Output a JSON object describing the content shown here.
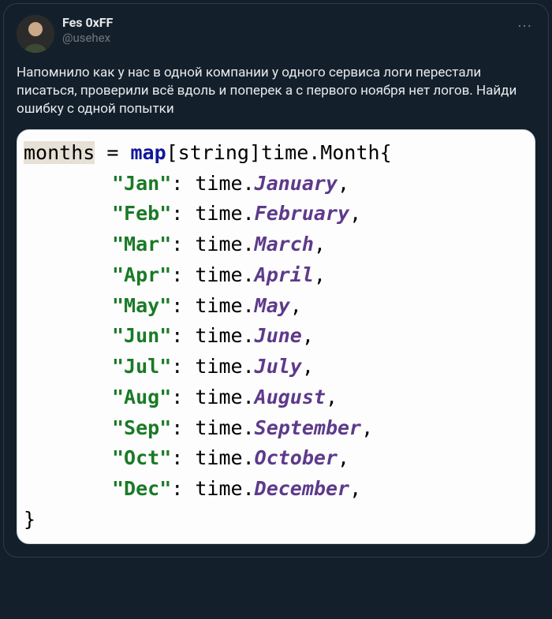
{
  "user": {
    "display_name": "Fes 0xFF",
    "handle": "@usehex"
  },
  "more_label": "···",
  "body": "Напомнило как у нас в одной компании у одного сервиса логи перестали писаться, проверили всё вдоль и поперек а с первого ноября нет логов. Найди ошибку с одной попытки",
  "code": {
    "var_name": "months",
    "assign": " = ",
    "map_kw": "map",
    "map_key_type": "[string]",
    "map_val_type": "time.Month",
    "open": "{",
    "close": "}",
    "entries": [
      {
        "key": "\"Jan\"",
        "sep": ": ",
        "obj": "time.",
        "prop": "January",
        "comma": ","
      },
      {
        "key": "\"Feb\"",
        "sep": ": ",
        "obj": "time.",
        "prop": "February",
        "comma": ","
      },
      {
        "key": "\"Mar\"",
        "sep": ": ",
        "obj": "time.",
        "prop": "March",
        "comma": ","
      },
      {
        "key": "\"Apr\"",
        "sep": ": ",
        "obj": "time.",
        "prop": "April",
        "comma": ","
      },
      {
        "key": "\"May\"",
        "sep": ": ",
        "obj": "time.",
        "prop": "May",
        "comma": ","
      },
      {
        "key": "\"Jun\"",
        "sep": ": ",
        "obj": "time.",
        "prop": "June",
        "comma": ","
      },
      {
        "key": "\"Jul\"",
        "sep": ": ",
        "obj": "time.",
        "prop": "July",
        "comma": ","
      },
      {
        "key": "\"Aug\"",
        "sep": ": ",
        "obj": "time.",
        "prop": "August",
        "comma": ","
      },
      {
        "key": "\"Sep\"",
        "sep": ": ",
        "obj": "time.",
        "prop": "September",
        "comma": ","
      },
      {
        "key": "\"Oct\"",
        "sep": ": ",
        "obj": "time.",
        "prop": "October",
        "comma": ","
      },
      {
        "key": "\"Dec\"",
        "sep": ": ",
        "obj": "time.",
        "prop": "December",
        "comma": ","
      }
    ]
  }
}
